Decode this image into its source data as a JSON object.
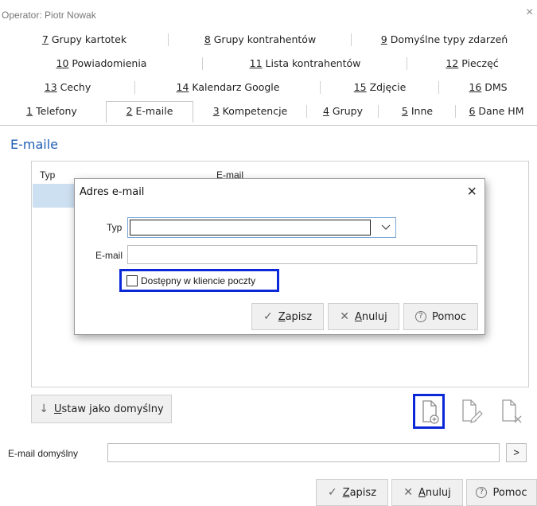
{
  "window": {
    "title": "Operator: Piotr Nowak",
    "close_glyph": "×"
  },
  "tabs": {
    "row1": [
      {
        "num": "7",
        "label": " Grupy kartotek"
      },
      {
        "num": "8",
        "label": " Grupy kontrahentów"
      },
      {
        "num": "9",
        "label": " Domyślne typy zdarzeń"
      }
    ],
    "row2": [
      {
        "num": "10",
        "label": " Powiadomienia"
      },
      {
        "num": "11",
        "label": " Lista kontrahentów"
      },
      {
        "num": "12",
        "label": " Pieczęć"
      }
    ],
    "row3": [
      {
        "num": "13",
        "label": " Cechy"
      },
      {
        "num": "14",
        "label": " Kalendarz Google"
      },
      {
        "num": "15",
        "label": " Zdjęcie"
      },
      {
        "num": "16",
        "label": " DMS"
      }
    ],
    "row4": [
      {
        "num": "1",
        "label": " Telefony"
      },
      {
        "num": "2",
        "label": " E-maile"
      },
      {
        "num": "3",
        "label": " Kompetencje"
      },
      {
        "num": "4",
        "label": " Grupy"
      },
      {
        "num": "5",
        "label": " Inne"
      },
      {
        "num": "6",
        "label": " Dane HM"
      }
    ],
    "active": "2"
  },
  "section": {
    "title": "E-maile"
  },
  "list": {
    "columns": [
      "Typ",
      "E-mail"
    ]
  },
  "buttons": {
    "set_default": {
      "prefix": "U",
      "label": "staw jako domyślny",
      "icon": "arrow-down-icon",
      "glyph": "↓"
    },
    "save": {
      "prefix": "Z",
      "label": "apisz",
      "icon": "check-icon",
      "glyph": "✓"
    },
    "cancel": {
      "prefix": "A",
      "label": "nuluj",
      "icon": "x-icon",
      "glyph": "✕"
    },
    "help": {
      "label": "Pomoc",
      "icon": "help-icon",
      "glyph": "?"
    }
  },
  "default_email": {
    "label": "E-mail domyślny",
    "value": "",
    "browse_glyph": ">"
  },
  "dialog": {
    "title": "Adres e-mail",
    "close_glyph": "×",
    "type_label": "Typ",
    "type_value": "",
    "email_label": "E-mail",
    "email_value": "",
    "checkbox_label": "Dostępny w kliencie poczty",
    "checkbox_checked": false
  },
  "colors": {
    "accent": "#1f5fb4",
    "highlight_border": "#0a28d8",
    "selection": "#cde0f1"
  }
}
